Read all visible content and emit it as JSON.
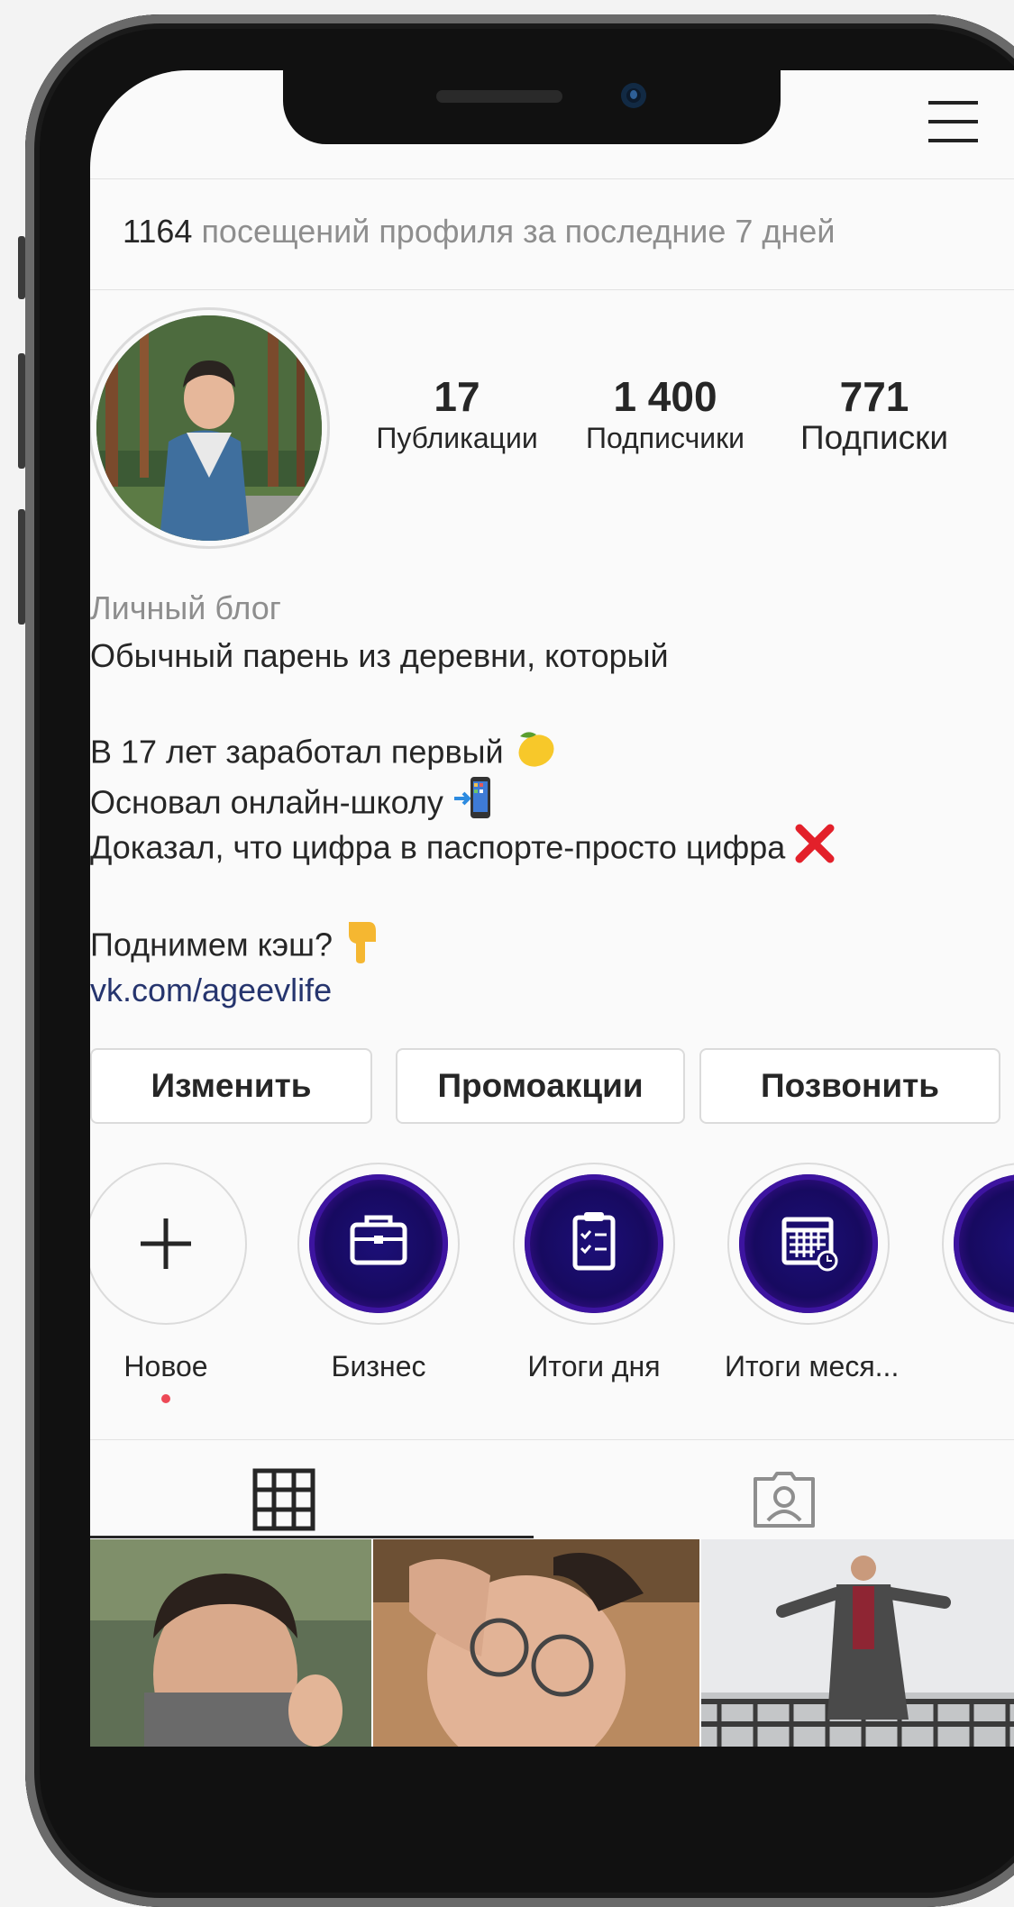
{
  "insights": {
    "count": "1164",
    "label": "посещений профиля за последние 7 дней"
  },
  "stats": [
    {
      "num": "17",
      "label": "Публикации"
    },
    {
      "num": "1 400",
      "label": "Подписчики"
    },
    {
      "num": "771",
      "label": "Подписки"
    }
  ],
  "bio": {
    "category": "Личный блог",
    "line1": "Обычный парень из деревни, который",
    "line2": "В 17 лет заработал первый",
    "line3": "Основал онлайн-школу",
    "line4": "Доказал, что цифра в паспорте-просто цифра",
    "line5": "Поднимем кэш?",
    "link": "vk.com/ageevlife"
  },
  "buttons": {
    "edit": "Изменить",
    "promo": "Промоакции",
    "call": "Позвонить"
  },
  "highlights": [
    {
      "label": "Новое",
      "icon": "plus-icon"
    },
    {
      "label": "Бизнес",
      "icon": "briefcase-icon"
    },
    {
      "label": "Итоги дня",
      "icon": "clipboard-icon"
    },
    {
      "label": "Итоги меся...",
      "icon": "calendar-icon"
    }
  ],
  "tabs": [
    {
      "icon": "grid-icon"
    },
    {
      "icon": "tagged-icon"
    }
  ],
  "colors": {
    "accent_dot": "#ed4956",
    "link": "#26356e",
    "highlight_bg": "#1c0f78"
  }
}
